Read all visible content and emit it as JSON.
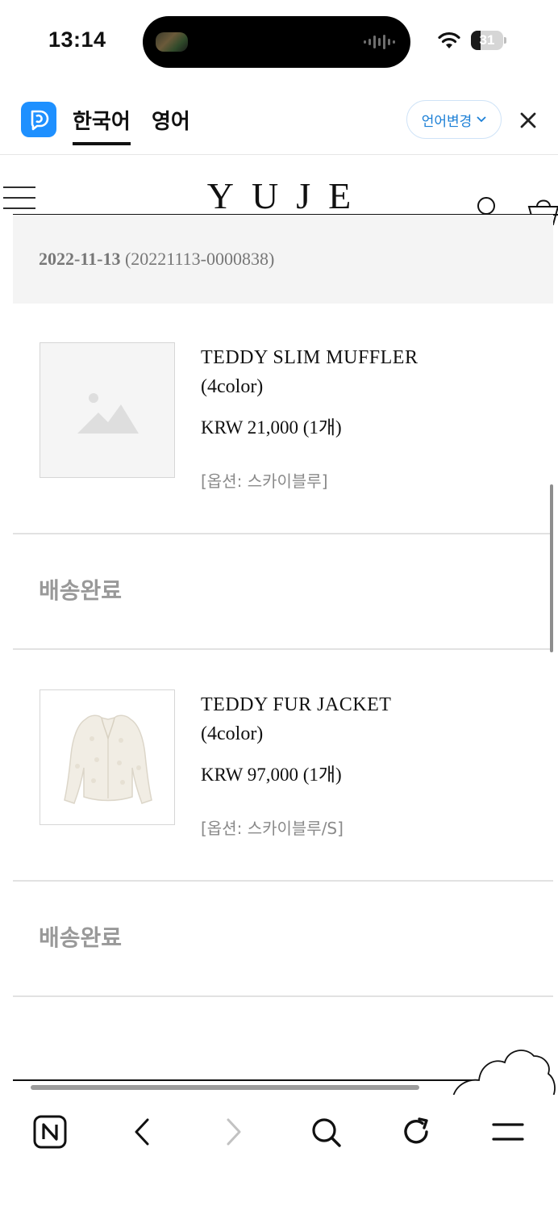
{
  "status_bar": {
    "time": "13:14",
    "battery_level": "31"
  },
  "translate_bar": {
    "tabs": [
      {
        "label": "한국어",
        "active": true
      },
      {
        "label": "영어",
        "active": false
      }
    ],
    "language_change_label": "언어변경",
    "accent_color": "#1E90FF"
  },
  "site": {
    "logo": "YUJE"
  },
  "order": {
    "date": "2022-11-13",
    "number": "(20221113-0000838)"
  },
  "items": [
    {
      "name": "TEDDY SLIM MUFFLER",
      "variant": "(4color)",
      "price": "KRW 21,000 (1개)",
      "option": "[옵션: 스카이블루]",
      "image": "placeholder-image-icon",
      "status": "배송완료"
    },
    {
      "name": "TEDDY FUR JACKET",
      "variant": "(4color)",
      "price": "KRW 97,000 (1개)",
      "option": "[옵션: 스카이블루/S]",
      "image": "cream-fur-jacket-photo",
      "status": "배송완료"
    }
  ],
  "toolbar": {
    "icons": [
      "naver-home-icon",
      "back-arrow-icon",
      "forward-arrow-icon",
      "search-icon",
      "refresh-icon",
      "menu-icon"
    ]
  }
}
